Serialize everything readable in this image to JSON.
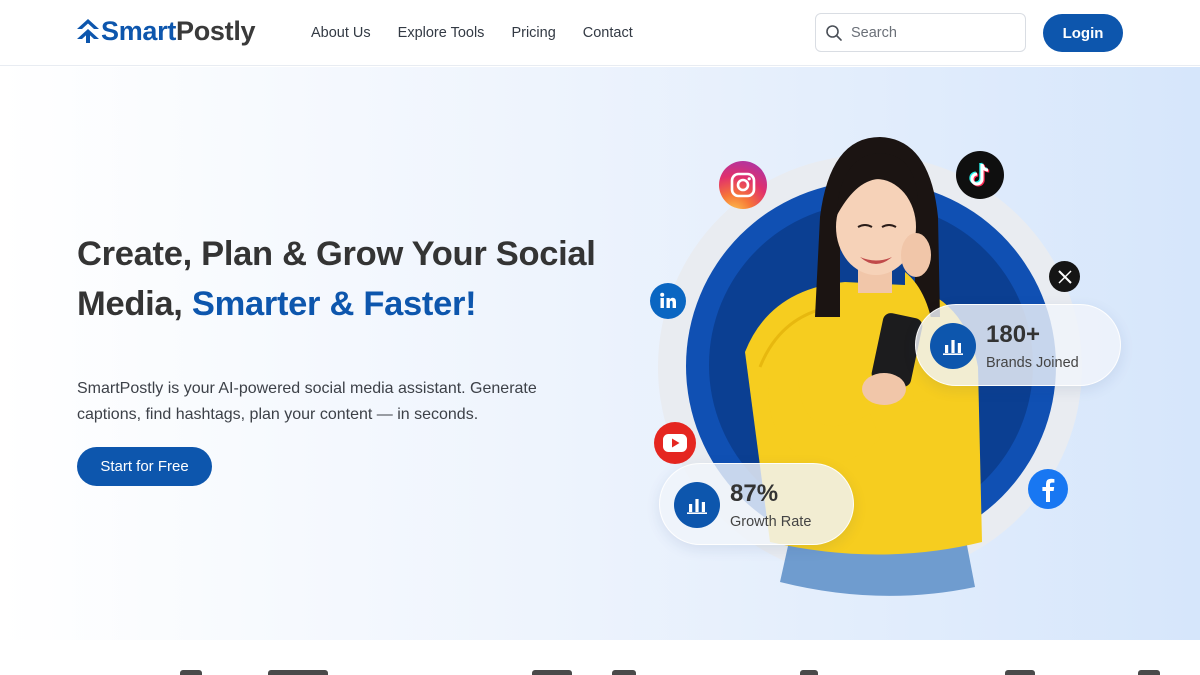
{
  "brand": {
    "name_part1": "Smart",
    "name_part2": "Postly"
  },
  "nav": {
    "items": [
      "About Us",
      "Explore Tools",
      "Pricing",
      "Contact"
    ]
  },
  "search": {
    "placeholder": "Search",
    "value": ""
  },
  "header": {
    "login_label": "Login"
  },
  "hero": {
    "headline_part1": "Create, Plan & Grow Your Social Media,",
    "headline_accent": "Smarter & Faster!",
    "subtext": "SmartPostly is your AI-powered social media assistant. Generate captions, find hashtags, plan your content — in seconds.",
    "cta_label": "Start for Free"
  },
  "stats": [
    {
      "value": "180+",
      "label": "Brands Joined"
    },
    {
      "value": "87%",
      "label": "Growth Rate"
    }
  ],
  "social_icons": [
    "instagram-icon",
    "tiktok-icon",
    "x-icon",
    "linkedin-icon",
    "youtube-icon",
    "facebook-icon"
  ],
  "colors": {
    "brand_blue": "#0d56ad",
    "dark_text": "#343434",
    "hero_gradient_end": "#d6e6fb"
  }
}
